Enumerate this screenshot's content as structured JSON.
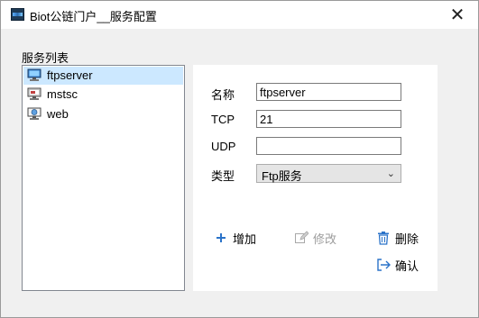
{
  "window": {
    "title": "Biot公链门户__服务配置",
    "close_glyph": "✕"
  },
  "service_list": {
    "group_label": "服务列表",
    "items": [
      {
        "label": "ftpserver",
        "icon": "computer-network-icon",
        "selected": true
      },
      {
        "label": "mstsc",
        "icon": "remote-desktop-icon",
        "selected": false
      },
      {
        "label": "web",
        "icon": "web-server-icon",
        "selected": false
      }
    ]
  },
  "form": {
    "name_label": "名称",
    "name_value": "ftpserver",
    "tcp_label": "TCP",
    "tcp_value": "21",
    "udp_label": "UDP",
    "udp_value": "",
    "type_label": "类型",
    "type_value": "Ftp服务"
  },
  "actions": {
    "add_label": "增加",
    "edit_label": "修改",
    "delete_label": "删除",
    "confirm_label": "确认"
  },
  "colors": {
    "selection": "#cce8ff",
    "accent": "#2b73c9"
  }
}
